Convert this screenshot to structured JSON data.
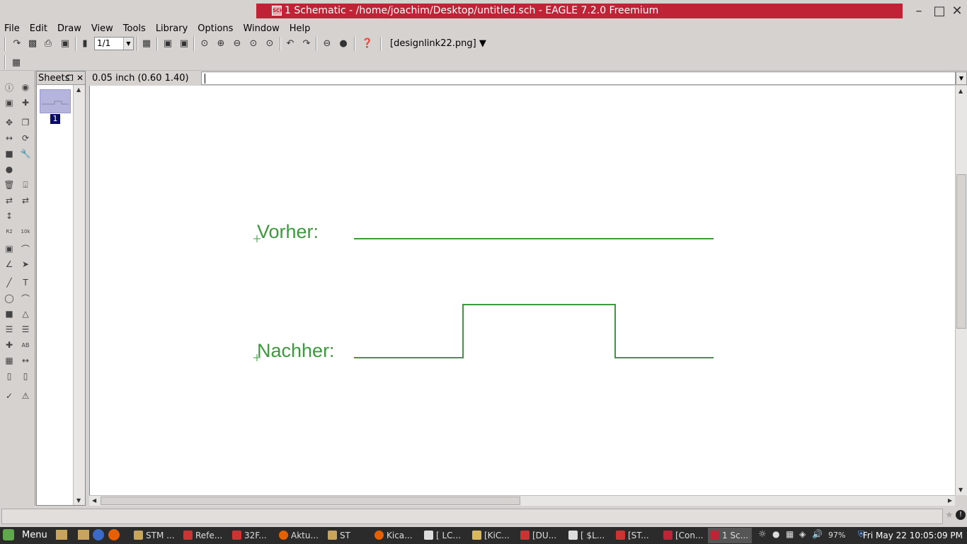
{
  "window": {
    "title": "1 Schematic - /home/joachim/Desktop/untitled.sch - EAGLE 7.2.0 Freemium",
    "icon_label": "SCH"
  },
  "menu": [
    "File",
    "Edit",
    "Draw",
    "View",
    "Tools",
    "Library",
    "Options",
    "Window",
    "Help"
  ],
  "toolbar": {
    "sheet_select": "1/1",
    "design_link": "[designlink22.png]"
  },
  "sheets_panel": {
    "title": "Sheets",
    "sheet_number": "1"
  },
  "coord_display": "0.05 inch (0.60 1.40)",
  "command_line": "",
  "schematic": {
    "label_before": "Vorher:",
    "label_after": "Nachher:",
    "line_color": "#3c9a3c",
    "signal_before": [
      0,
      0
    ],
    "signal_after": [
      0,
      1,
      0
    ]
  },
  "taskbar": {
    "start_label": "Menu",
    "items": [
      "STM ...",
      "Refe...",
      "32F...",
      "Aktu...",
      "ST",
      "Kica...",
      "[ LC...",
      "[KiC...",
      "[DU...",
      "[ $L...",
      "[ST...",
      "[Con...",
      "1 Sc..."
    ],
    "battery": "97%",
    "clock": "Fri May 22 10:05:09 PM"
  }
}
